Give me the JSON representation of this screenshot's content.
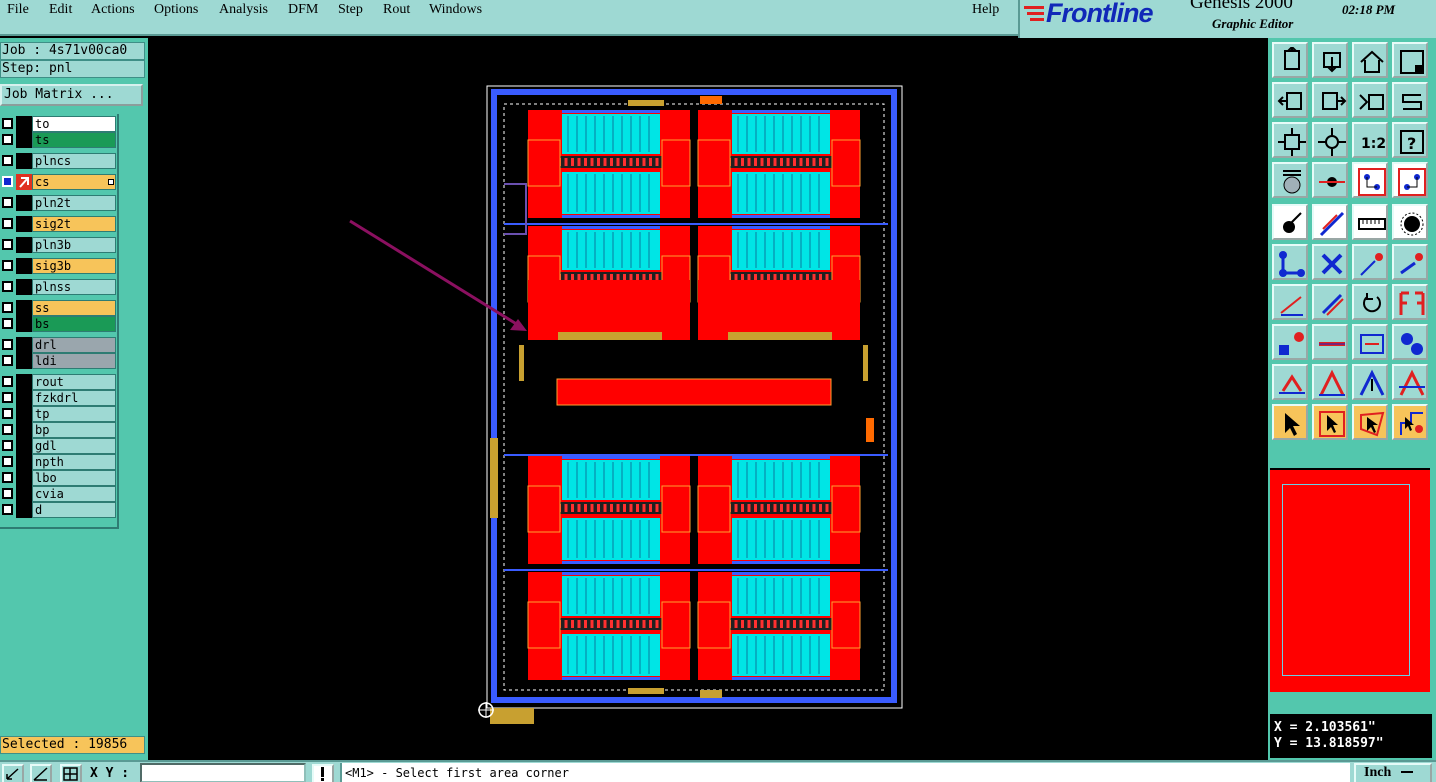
{
  "menu": {
    "items": [
      "File",
      "Edit",
      "Actions",
      "Options",
      "Analysis",
      "DFM",
      "Step",
      "Rout",
      "Windows"
    ],
    "help": "Help"
  },
  "brand": {
    "logo": "Frontline",
    "product": "Genesis 2000",
    "subtitle": "Graphic Editor",
    "clock": "02:18 PM"
  },
  "job": {
    "job_label": "Job : 4s71v00ca0",
    "step_label": "Step: pnl",
    "matrix_button": "Job Matrix ..."
  },
  "layers": [
    {
      "name": "to",
      "color": "#ffffff",
      "selected": false
    },
    {
      "name": "ts",
      "color": "#1a9a56",
      "selected": false
    },
    {
      "name": "plncs",
      "color": "#9ed9d3",
      "selected": false
    },
    {
      "name": "cs",
      "color": "#f7c45a",
      "selected": true
    },
    {
      "name": "pln2t",
      "color": "#9ed9d3",
      "selected": false
    },
    {
      "name": "sig2t",
      "color": "#f7c45a",
      "selected": false
    },
    {
      "name": "pln3b",
      "color": "#9ed9d3",
      "selected": false
    },
    {
      "name": "sig3b",
      "color": "#f7c45a",
      "selected": false
    },
    {
      "name": "plnss",
      "color": "#9ed9d3",
      "selected": false
    },
    {
      "name": "ss",
      "color": "#f7c45a",
      "selected": false
    },
    {
      "name": "bs",
      "color": "#1a9a56",
      "selected": false
    },
    {
      "name": "drl",
      "color": "#9aa6ad",
      "selected": false
    },
    {
      "name": "ldi",
      "color": "#9aa6ad",
      "selected": false
    },
    {
      "name": "rout",
      "color": "#9ed9d3",
      "selected": false
    },
    {
      "name": "fzkdrl",
      "color": "#9ed9d3",
      "selected": false
    },
    {
      "name": "tp",
      "color": "#9ed9d3",
      "selected": false
    },
    {
      "name": "bp",
      "color": "#9ed9d3",
      "selected": false
    },
    {
      "name": "gdl",
      "color": "#9ed9d3",
      "selected": false
    },
    {
      "name": "npth",
      "color": "#9ed9d3",
      "selected": false
    },
    {
      "name": "lbo",
      "color": "#9ed9d3",
      "selected": false
    },
    {
      "name": "cvia",
      "color": "#9ed9d3",
      "selected": false
    },
    {
      "name": "d",
      "color": "#9ed9d3",
      "selected": false
    }
  ],
  "status": {
    "selected": "Selected : 19856",
    "x": "X = 2.103561\"",
    "y": "Y = 13.818597\""
  },
  "bottom": {
    "xy_label": "X Y :",
    "xy_value": "",
    "prompt": "<M1> - Select first area corner",
    "units": "Inch"
  },
  "colors": {
    "panel": "#53c7ad",
    "light": "#9ed9d3",
    "copper": "#ff0000",
    "cyan": "#00e5e5",
    "frame": "#3a5cff"
  }
}
